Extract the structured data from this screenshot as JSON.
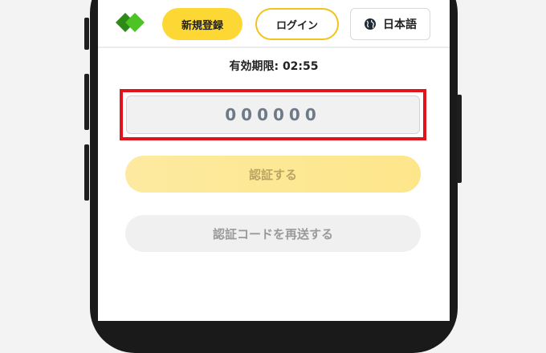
{
  "header": {
    "register_label": "新規登録",
    "login_label": "ログイン",
    "language_label": "日本語",
    "language_icon": "globe-icon",
    "logo_icon": "green-diamond-logo"
  },
  "verification": {
    "expiry_text": "有効期限: 02:55",
    "code_placeholder": "000000",
    "verify_label": "認証する",
    "resend_label": "認証コードを再送する"
  },
  "colors": {
    "accent_yellow": "#fdd835",
    "highlight_red": "#e0141a",
    "logo_green": "#3cb41e"
  }
}
